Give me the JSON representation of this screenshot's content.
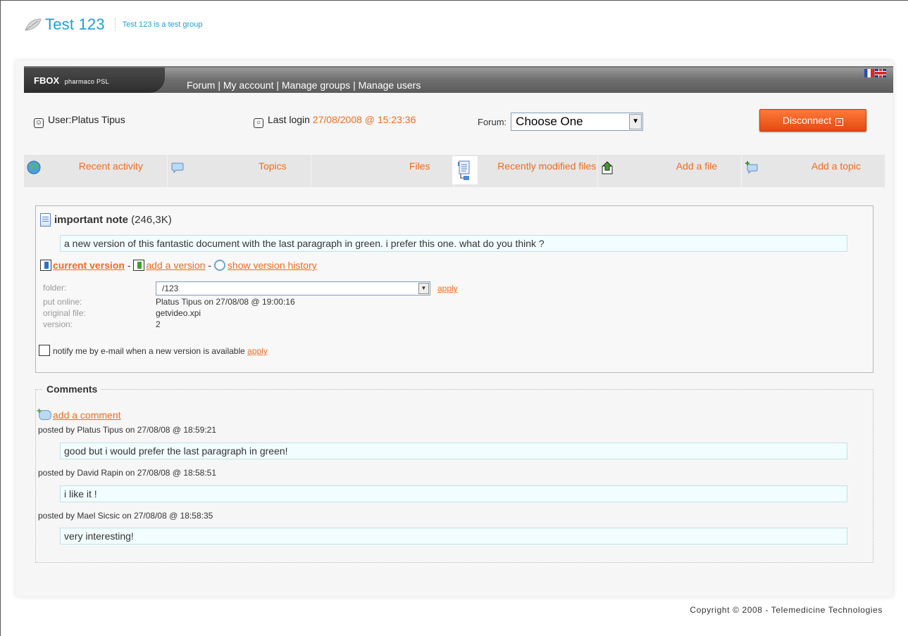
{
  "site": {
    "title": "Test 123",
    "description": "Test 123 is a test group"
  },
  "topbar": {
    "brand": "FBOX",
    "brand_sub": "pharmaco PSL",
    "nav": [
      "Forum",
      "My account",
      "Manage groups",
      "Manage users"
    ],
    "nav_sep": " | "
  },
  "user": {
    "label": "User:Platus Tipus",
    "last_login_label": "Last login",
    "last_login_date": "27/08/2008 @ 15:23:36",
    "forum_label": "Forum:",
    "forum_selected": "Choose One",
    "disconnect_label": "Disconnect"
  },
  "tabs": [
    {
      "label": "Recent activity",
      "icon": "globe-icon"
    },
    {
      "label": "Topics",
      "icon": "speech-bubble-icon"
    },
    {
      "label": "Files",
      "icon": "tree-icon"
    },
    {
      "label": "Recently modified files",
      "icon": "document-icon"
    },
    {
      "label": "Add a file",
      "icon": "upload-icon"
    },
    {
      "label": "Add a topic",
      "icon": "add-bubble-icon"
    }
  ],
  "document": {
    "name": "important note",
    "size": "(246,3K)",
    "description": "a new version of this fantastic document with the last paragraph in green. i prefer this one. what do you think ?",
    "current_version_label": "current version",
    "add_version_label": "add a version",
    "version_history_label": "show version history",
    "dash": " - ",
    "folder_label": "folder:",
    "folder_value": "/123",
    "apply_label": "apply",
    "put_online_label": "put online:",
    "put_online_value": "Platus Tipus on 27/08/08 @ 19:00:16",
    "original_file_label": "original file:",
    "original_file_value": "getvideo.xpi",
    "version_label": "version:",
    "version_value": "2",
    "notify_label": "notify me by e-mail when a new version is available",
    "notify_apply": "apply"
  },
  "comments": {
    "title": "Comments",
    "add_label": "add a comment",
    "items": [
      {
        "meta": "posted by  Platus Tipus on 27/08/08 @ 18:59:21",
        "text": "good but i would prefer the last paragraph in green!"
      },
      {
        "meta": "posted by  David Rapin on 27/08/08 @ 18:58:51",
        "text": "i like it !"
      },
      {
        "meta": "posted by  Mael Sicsic on 27/08/08 @ 18:58:35",
        "text": "very interesting!"
      }
    ]
  },
  "footer": {
    "copyright": "Copyright © 2008 - Telemedicine Technologies"
  }
}
